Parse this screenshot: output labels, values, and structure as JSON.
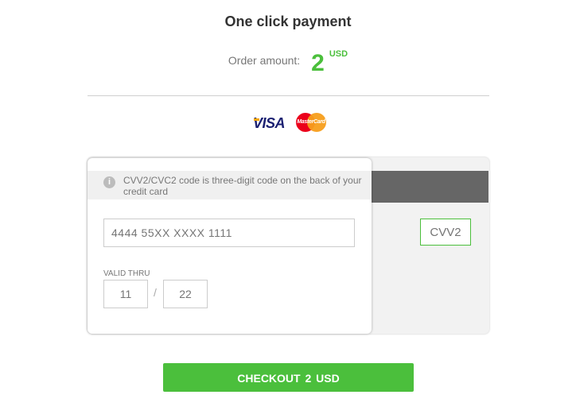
{
  "header": {
    "title": "One click payment"
  },
  "order": {
    "label": "Order amount:",
    "amount": "2",
    "currency": "USD"
  },
  "logos": {
    "visa": "VISA",
    "mastercard": "MasterCard"
  },
  "card": {
    "cvv_notice": "CVV2/CVC2 code is three-digit code on the back of your credit card",
    "number_placeholder": "4444 55XX XXXX 1111",
    "valid_thru_label": "VALID THRU",
    "month_placeholder": "11",
    "year_placeholder": "22",
    "cvv_placeholder": "CVV2"
  },
  "checkout": {
    "label": "CHECKOUT  2  USD"
  },
  "colors": {
    "accent": "#4bbf3c",
    "stripe": "#666666"
  }
}
